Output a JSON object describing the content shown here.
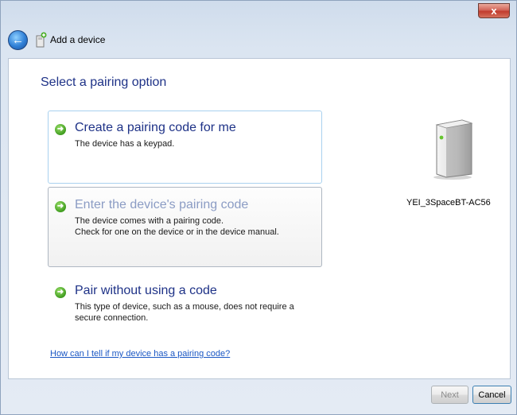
{
  "window": {
    "title": "Add a device",
    "close_label": "x"
  },
  "main": {
    "heading": "Select a pairing option",
    "options": [
      {
        "title": "Create a pairing code for me",
        "description": "The device has a keypad."
      },
      {
        "title": "Enter the device's pairing code",
        "description_line1": "The device comes with a pairing code.",
        "description_line2": "Check for one on the device or in the device manual."
      },
      {
        "title": "Pair without using a code",
        "description_line1": "This type of device, such as a mouse, does not require a",
        "description_line2": "secure connection."
      }
    ],
    "help_link": "How can I tell if my device has a pairing code?"
  },
  "device": {
    "name": "YEI_3SpaceBT-AC56",
    "icon": "device-tower-icon"
  },
  "footer": {
    "next_label": "Next",
    "cancel_label": "Cancel"
  },
  "colors": {
    "heading": "#1e3287",
    "link": "#1a57c4",
    "selected_border": "#a9d1ef",
    "arrow_green": "#3f9c1f"
  }
}
